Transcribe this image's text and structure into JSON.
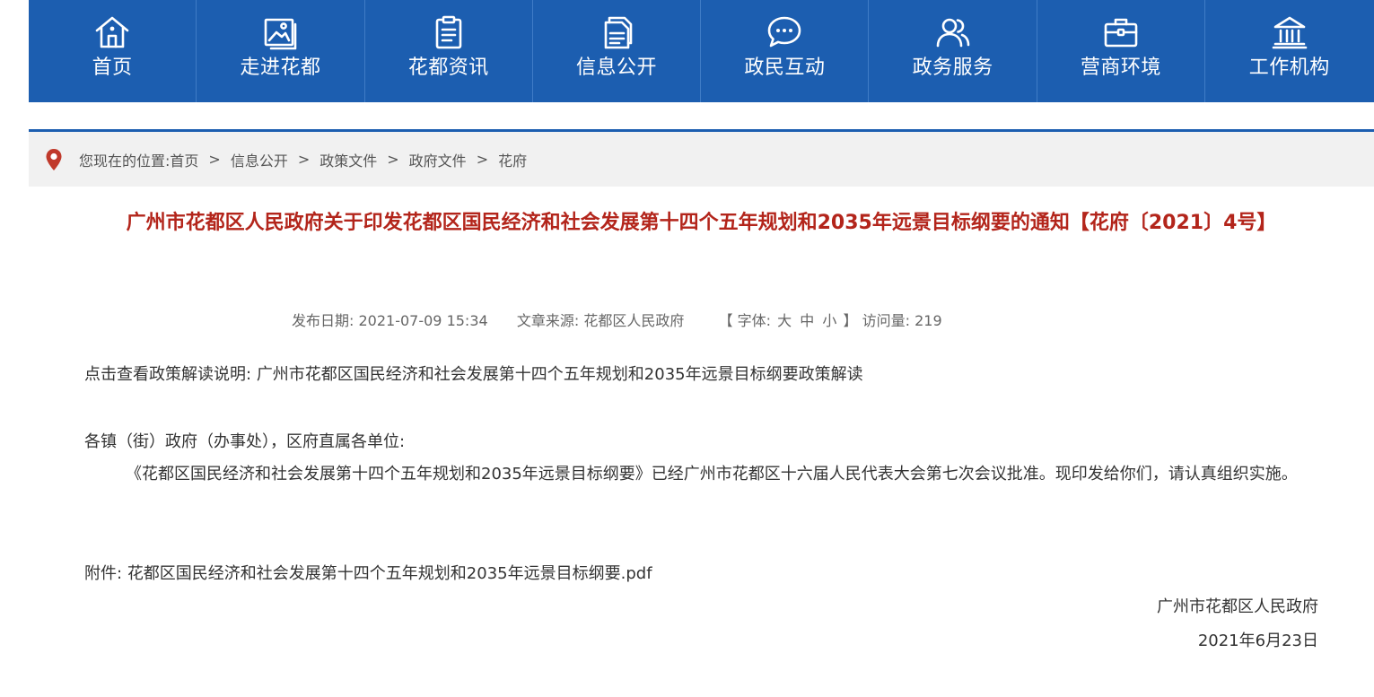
{
  "nav": {
    "items": [
      {
        "label": "首页",
        "icon": "home-icon"
      },
      {
        "label": "走进花都",
        "icon": "picture-icon"
      },
      {
        "label": "花都资讯",
        "icon": "clipboard-icon"
      },
      {
        "label": "信息公开",
        "icon": "document-icon"
      },
      {
        "label": "政民互动",
        "icon": "chat-bubble-icon"
      },
      {
        "label": "政务服务",
        "icon": "users-icon"
      },
      {
        "label": "营商环境",
        "icon": "briefcase-icon"
      },
      {
        "label": "工作机构",
        "icon": "government-building-icon"
      }
    ],
    "background": "#1c5eb0"
  },
  "breadcrumb": {
    "prefix": "您现在的位置: ",
    "items": [
      "首页",
      "信息公开",
      "政策文件",
      "政府文件",
      "花府"
    ],
    "separator": ">",
    "icon": "location-pin-icon",
    "icon_color": "#c0392b"
  },
  "article": {
    "title": "广州市花都区人民政府关于印发花都区国民经济和社会发展第十四个五年规划和2035年远景目标纲要的通知【花府〔2021〕4号】",
    "title_color": "#b3251b",
    "meta": {
      "date_label": "发布日期:",
      "date": "2021-07-09 15:34",
      "source_label": "文章来源:",
      "source": "花都区人民政府",
      "font_open": "【 字体:",
      "font_large": "大",
      "font_medium": "中",
      "font_small": "小",
      "font_close": "】",
      "visits_label": "访问量:",
      "visits": "219"
    },
    "interpretation_label": "点击查看政策解读说明:",
    "interpretation_link": "广州市花都区国民经济和社会发展第十四个五年规划和2035年远景目标纲要政策解读",
    "salutation": "各镇（街）政府（办事处），区府直属各单位:",
    "paragraph": "《花都区国民经济和社会发展第十四个五年规划和2035年远景目标纲要》已经广州市花都区十六届人民代表大会第七次会议批准。现印发给你们，请认真组织实施。",
    "attachment_label": "附件:",
    "attachment_link": "花都区国民经济和社会发展第十四个五年规划和2035年远景目标纲要.pdf",
    "signature": "广州市花都区人民政府",
    "sign_date": "2021年6月23日"
  }
}
